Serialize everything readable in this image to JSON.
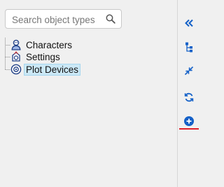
{
  "search": {
    "placeholder": "Search object types",
    "value": ""
  },
  "tree": {
    "items": [
      {
        "label": "Characters",
        "icon": "character-icon",
        "selected": false
      },
      {
        "label": "Settings",
        "icon": "settings-icon",
        "selected": false
      },
      {
        "label": "Plot Devices",
        "icon": "plot-device-icon",
        "selected": true
      }
    ]
  },
  "toolbar": {
    "buttons": [
      {
        "name": "collapse-panel",
        "icon": "double-chevron-left-icon"
      },
      {
        "name": "hierarchy",
        "icon": "hierarchy-icon"
      },
      {
        "name": "collapse-all",
        "icon": "collapse-arrows-icon"
      },
      {
        "name": "refresh",
        "icon": "refresh-icon"
      },
      {
        "name": "add",
        "icon": "plus-circle-icon",
        "active": true
      }
    ]
  },
  "colors": {
    "accent": "#1461c8",
    "selection_bg": "#cbe8f6",
    "active_underline": "#e0202a",
    "background": "#f0f0f0"
  }
}
